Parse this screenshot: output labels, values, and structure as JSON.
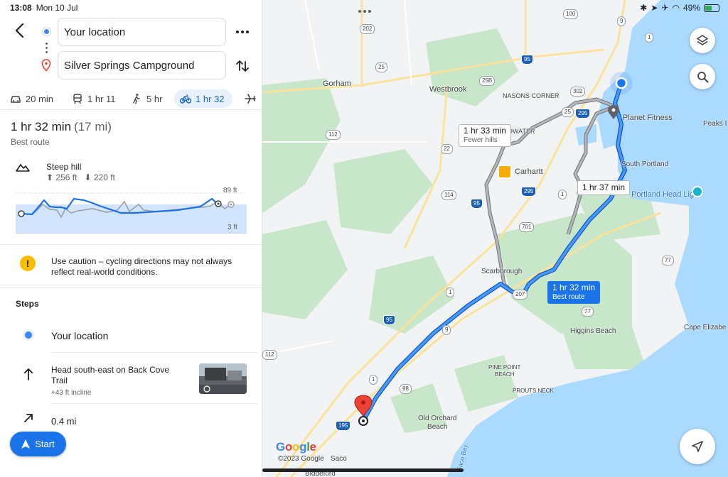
{
  "status": {
    "time": "13:08",
    "date": "Mon 10 Jul",
    "battery": "49%"
  },
  "search": {
    "from": "Your location",
    "to": "Silver Springs Campground"
  },
  "modes": [
    {
      "icon": "car-icon",
      "label": "20 min"
    },
    {
      "icon": "transit-icon",
      "label": "1 hr 11"
    },
    {
      "icon": "walk-icon",
      "label": "5 hr"
    },
    {
      "icon": "bike-icon",
      "label": "1 hr 32",
      "active": true
    }
  ],
  "summary": {
    "time": "1 hr 32 min",
    "distance": "(17 mi)",
    "subtitle": "Best route"
  },
  "elevation": {
    "title": "Steep hill",
    "ascent": "256 ft",
    "descent": "220 ft",
    "max_label": "89 ft",
    "min_label": "3 ft"
  },
  "warning": {
    "text": "Use caution – cycling directions may not always reflect real-world conditions."
  },
  "steps": {
    "heading": "Steps",
    "origin": "Your location",
    "step1": {
      "text": "Head south-east on Back Cove Trail",
      "sub": "+43 ft incline"
    },
    "step2": {
      "text": "0.4 mi"
    }
  },
  "start_label": "Start",
  "map": {
    "places": {
      "gorham": "Gorham",
      "westbrook": "Westbrook",
      "nasons_corner": "NASONS CORNER",
      "downtown": "OWATER",
      "planet_fitness": "Planet Fitness",
      "peaks": "Peaks I",
      "carhartt": "Carhartt",
      "south_portland": "South Portland",
      "portland_head": "Portland Head Light",
      "scarborough": "Scarborough",
      "higgins": "Higgins Beach",
      "cape_elizabeth": "Cape Elizabe",
      "pine_point": "PINE POINT\nBEACH",
      "prouts": "PROUTS NECK",
      "old_orchard": "Old Orchard\nBeach",
      "saco": "Saco",
      "biddeford": "Biddeford",
      "saco_bay": "Saco Bay"
    },
    "shields": [
      "100",
      "9",
      "1",
      "202",
      "95",
      "25",
      "25B",
      "302",
      "25",
      "295",
      "22",
      "114",
      "295",
      "1",
      "95",
      "701",
      "112",
      "1",
      "207",
      "9",
      "95",
      "77",
      "77",
      "1",
      "98",
      "195",
      "112"
    ],
    "routes": [
      {
        "time": "1 hr 33 min",
        "sub": "Fewer hills"
      },
      {
        "time": "1 hr 37 min",
        "sub": ""
      },
      {
        "time": "1 hr 32 min",
        "sub": "Best route"
      }
    ],
    "logo": "Google",
    "copyright": "©2023 Google"
  },
  "colors": {
    "route": "#1a73e8",
    "alt_route": "#9aa0a6",
    "water": "#aadaff",
    "park": "#c8e6c9",
    "land": "#f1f3f4"
  }
}
